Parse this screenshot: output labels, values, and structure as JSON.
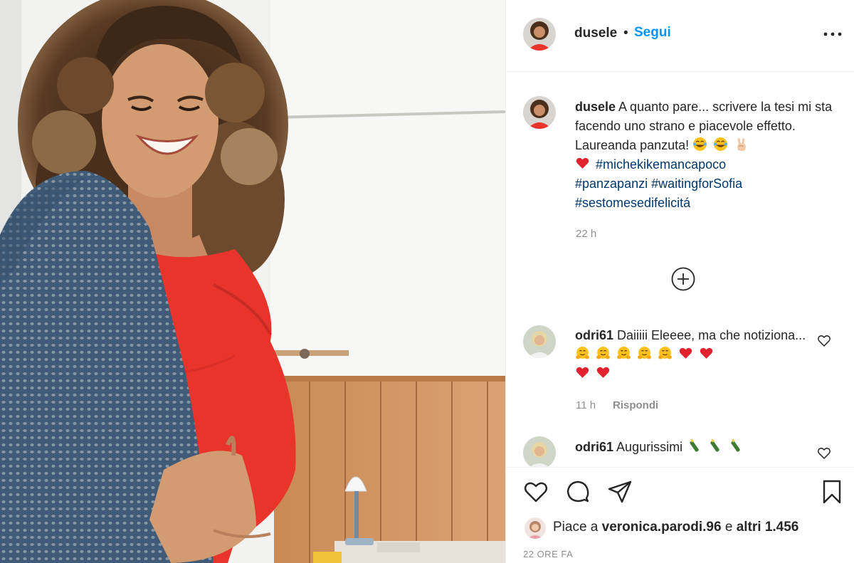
{
  "post": {
    "author": "dusele",
    "follow_separator": "•",
    "follow_label": "Segui",
    "more_label": "•••"
  },
  "caption": {
    "username": "dusele",
    "text": "A quanto pare... scrivere la tesi mi sta facendo uno strano e piacevole effetto. Laureanda panzuta!",
    "emojis_line1": [
      "joy-emoji",
      "joy-emoji",
      "victory-hand-emoji"
    ],
    "heart_emoji": "red-heart-emoji",
    "hashtags": [
      "#michekikemancapoco",
      "#panzapanzi",
      "#waitingforSofia",
      "#sestomesedifelicitá"
    ],
    "time": "22 h"
  },
  "load_more_icon": "plus-circle-icon",
  "comments": [
    {
      "username": "odri61",
      "text": "Daiiiii Eleeee, ma che notiziona...",
      "emojis": [
        "hugging-face-emoji",
        "hugging-face-emoji",
        "hugging-face-emoji",
        "hugging-face-emoji",
        "hugging-face-emoji",
        "red-heart-emoji",
        "red-heart-emoji",
        "red-heart-emoji",
        "red-heart-emoji"
      ],
      "time": "11 h",
      "reply_label": "Rispondi"
    },
    {
      "username": "odri61",
      "text": "Augurissimi",
      "emojis": [
        "champagne-emoji",
        "champagne-emoji",
        "champagne-emoji"
      ]
    }
  ],
  "actions": {
    "icons": [
      "heart-icon",
      "comment-icon",
      "share-icon",
      "bookmark-icon"
    ]
  },
  "likes": {
    "prefix": "Piace a",
    "user": "veronica.parodi.96",
    "connector": "e",
    "others": "altri 1.456"
  },
  "date": "22 ORE FA",
  "colors": {
    "link_blue": "#0095f6",
    "hashtag_blue": "#00376b",
    "text": "#262626",
    "muted": "#8e8e8e",
    "border": "#efefef",
    "dress_red": "#e9342c",
    "cardigan_blue": "#3f5f7f"
  }
}
